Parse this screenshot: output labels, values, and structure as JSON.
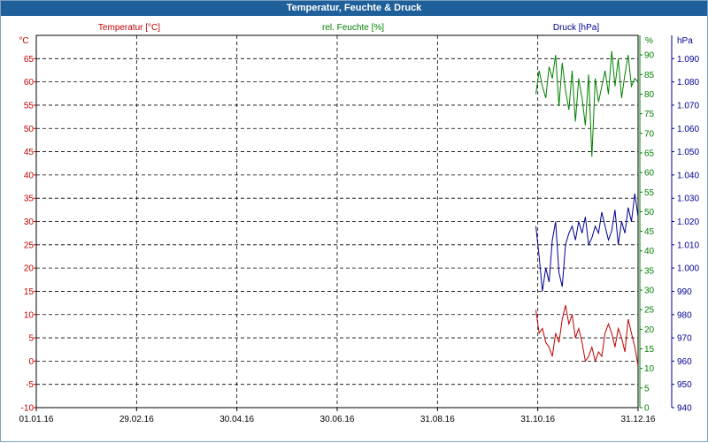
{
  "window_title": "Temperatur, Feuchte & Druck",
  "chart_data": {
    "type": "line",
    "title": "Temperatur, Feuchte & Druck",
    "x_ticks": [
      "01.01.16",
      "29.02.16",
      "30.04.16",
      "30.06.16",
      "31.08.16",
      "31.10.16",
      "31.12.16"
    ],
    "grid": true,
    "axes": {
      "temperature": {
        "label": "Temperatur [°C]",
        "unit": "°C",
        "range": [
          -10,
          70
        ],
        "ticks": [
          "-10",
          "-5",
          "0",
          "5",
          "10",
          "15",
          "20",
          "25",
          "30",
          "35",
          "40",
          "45",
          "50",
          "55",
          "60",
          "65"
        ],
        "color": "#c00000"
      },
      "humidity": {
        "label": "rel. Feuchte [%]",
        "unit": "%",
        "range": [
          0,
          95
        ],
        "ticks": [
          "0",
          "5",
          "10",
          "15",
          "20",
          "25",
          "30",
          "35",
          "40",
          "45",
          "50",
          "55",
          "60",
          "65",
          "70",
          "75",
          "80",
          "85",
          "90"
        ],
        "color": "#008000"
      },
      "pressure": {
        "label": "Druck [hPa]",
        "unit": "hPa",
        "range": [
          940,
          1100
        ],
        "ticks": [
          "940",
          "950",
          "960",
          "970",
          "980",
          "990",
          "1.000",
          "1.010",
          "1.020",
          "1.030",
          "1.040",
          "1.050",
          "1.060",
          "1.070",
          "1.080",
          "1.090"
        ],
        "color": "#000090"
      }
    },
    "series": [
      {
        "name": "Temperatur [°C]",
        "axis": "temperature",
        "color": "#c00000",
        "x": [
          "2016-10-30",
          "2016-11-01",
          "2016-11-03",
          "2016-11-05",
          "2016-11-07",
          "2016-11-09",
          "2016-11-11",
          "2016-11-13",
          "2016-11-15",
          "2016-11-17",
          "2016-11-19",
          "2016-11-21",
          "2016-11-23",
          "2016-11-25",
          "2016-11-27",
          "2016-11-29",
          "2016-12-01",
          "2016-12-03",
          "2016-12-05",
          "2016-12-07",
          "2016-12-09",
          "2016-12-11",
          "2016-12-13",
          "2016-12-15",
          "2016-12-17",
          "2016-12-19",
          "2016-12-21",
          "2016-12-23",
          "2016-12-25",
          "2016-12-27",
          "2016-12-29",
          "2016-12-31"
        ],
        "y": [
          11,
          6,
          7,
          4,
          3,
          1,
          6,
          4,
          9,
          12,
          8,
          10,
          5,
          7,
          4,
          0,
          1,
          3,
          0,
          2,
          1,
          6,
          8,
          6,
          3,
          7,
          5,
          2,
          9,
          6,
          3,
          -1
        ]
      },
      {
        "name": "rel. Feuchte [%]",
        "axis": "humidity",
        "color": "#008000",
        "x": [
          "2016-10-30",
          "2016-11-01",
          "2016-11-03",
          "2016-11-05",
          "2016-11-07",
          "2016-11-09",
          "2016-11-11",
          "2016-11-13",
          "2016-11-15",
          "2016-11-17",
          "2016-11-19",
          "2016-11-21",
          "2016-11-23",
          "2016-11-25",
          "2016-11-27",
          "2016-11-29",
          "2016-12-01",
          "2016-12-03",
          "2016-12-05",
          "2016-12-07",
          "2016-12-09",
          "2016-12-11",
          "2016-12-13",
          "2016-12-15",
          "2016-12-17",
          "2016-12-19",
          "2016-12-21",
          "2016-12-23",
          "2016-12-25",
          "2016-12-27",
          "2016-12-29",
          "2016-12-31"
        ],
        "y": [
          80,
          86,
          82,
          79,
          87,
          84,
          90,
          77,
          88,
          81,
          76,
          86,
          73,
          84,
          79,
          72,
          85,
          64,
          84,
          78,
          82,
          86,
          80,
          91,
          82,
          89,
          79,
          85,
          90,
          82,
          84,
          83
        ]
      },
      {
        "name": "Druck [hPa]",
        "axis": "pressure",
        "color": "#000090",
        "x": [
          "2016-10-30",
          "2016-11-01",
          "2016-11-03",
          "2016-11-05",
          "2016-11-07",
          "2016-11-09",
          "2016-11-11",
          "2016-11-13",
          "2016-11-15",
          "2016-11-17",
          "2016-11-19",
          "2016-11-21",
          "2016-11-23",
          "2016-11-25",
          "2016-11-27",
          "2016-11-29",
          "2016-12-01",
          "2016-12-03",
          "2016-12-05",
          "2016-12-07",
          "2016-12-09",
          "2016-12-11",
          "2016-12-13",
          "2016-12-15",
          "2016-12-17",
          "2016-12-19",
          "2016-12-21",
          "2016-12-23",
          "2016-12-25",
          "2016-12-27",
          "2016-12-29",
          "2016-12-31"
        ],
        "y": [
          1018,
          1005,
          990,
          1000,
          994,
          1012,
          1020,
          998,
          992,
          1010,
          1015,
          1018,
          1012,
          1020,
          1015,
          1022,
          1010,
          1013,
          1018,
          1015,
          1024,
          1018,
          1012,
          1016,
          1025,
          1010,
          1020,
          1015,
          1026,
          1020,
          1032,
          1022
        ]
      }
    ]
  }
}
